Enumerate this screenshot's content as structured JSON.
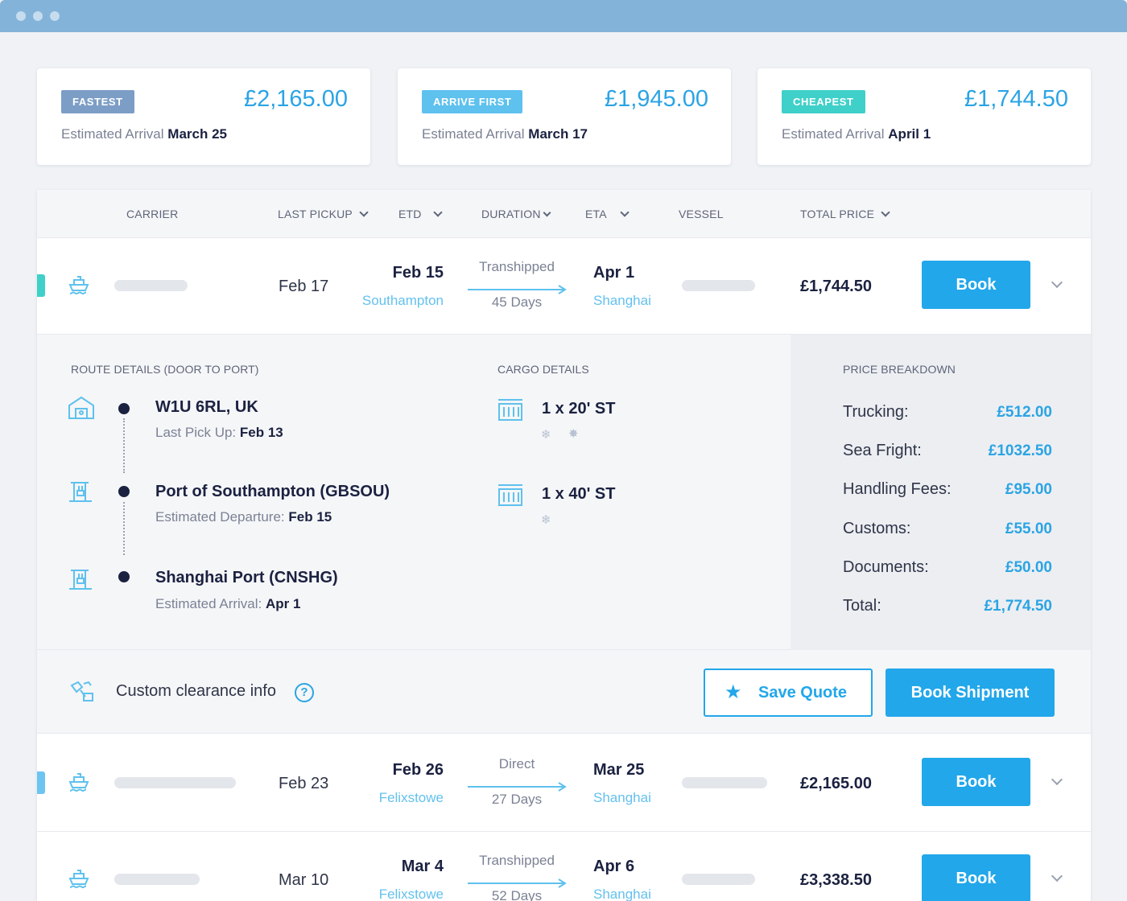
{
  "window": {
    "controls": [
      "dot",
      "dot",
      "dot"
    ]
  },
  "summary": [
    {
      "badge": "FASTEST",
      "badge_color": "#7c9ec6",
      "price": "£2,165.00",
      "arrival_label": "Estimated Arrival",
      "arrival_date": "March 25"
    },
    {
      "badge": "ARRIVE FIRST",
      "badge_color": "#5ec1ee",
      "price": "£1,945.00",
      "arrival_label": "Estimated Arrival",
      "arrival_date": "March 17"
    },
    {
      "badge": "CHEAPEST",
      "badge_color": "#3fd0c9",
      "price": "£1,744.50",
      "arrival_label": "Estimated Arrival",
      "arrival_date": "April 1"
    }
  ],
  "table_header": {
    "carrier": "CARRIER",
    "last_pickup": "LAST PICKUP",
    "etd": "ETD",
    "duration": "DURATION",
    "eta": "ETA",
    "vessel": "VESSEL",
    "total_price": "TOTAL PRICE"
  },
  "rows": [
    {
      "marker_color": "#3fd0c9",
      "pickup": "Feb 17",
      "etd_date": "Feb 15",
      "etd_port": "Southampton",
      "route_type": "Transhipped",
      "duration": "45 Days",
      "eta_date": "Apr 1",
      "eta_port": "Shanghai",
      "total": "£1,744.50",
      "book": "Book"
    },
    {
      "marker_color": "#6cc5f0",
      "pickup": "Feb 23",
      "etd_date": "Feb 26",
      "etd_port": "Felixstowe",
      "route_type": "Direct",
      "duration": "27 Days",
      "eta_date": "Mar 25",
      "eta_port": "Shanghai",
      "total": "£2,165.00",
      "book": "Book"
    },
    {
      "marker_color": "",
      "pickup": "Mar 10",
      "etd_date": "Mar 4",
      "etd_port": "Felixstowe",
      "route_type": "Transhipped",
      "duration": "52 Days",
      "eta_date": "Apr 6",
      "eta_port": "Shanghai",
      "total": "£3,338.50",
      "book": "Book"
    }
  ],
  "details": {
    "route_title": "ROUTE DETAILS (DOOR TO PORT)",
    "stops": [
      {
        "icon": "warehouse-icon",
        "name": "W1U 6RL, UK",
        "sub_label": "Last Pick Up:",
        "sub_value": "Feb 13"
      },
      {
        "icon": "port-crane-icon",
        "name": "Port of Southampton (GBSOU)",
        "sub_label": "Estimated Departure:",
        "sub_value": "Feb 15"
      },
      {
        "icon": "port-crane-icon",
        "name": "Shanghai Port (CNSHG)",
        "sub_label": "Estimated Arrival:",
        "sub_value": "Apr 1"
      }
    ],
    "cargo_title": "CARGO DETAILS",
    "cargo": [
      {
        "icon": "container-icon",
        "label": "1 x 20' ST",
        "tags": [
          "snowflake-icon",
          "hazard-icon"
        ]
      },
      {
        "icon": "container-icon",
        "label": "1 x 40' ST",
        "tags": [
          "snowflake-icon"
        ]
      }
    ],
    "price_title": "PRICE BREAKDOWN",
    "price_breakdown": [
      {
        "label": "Trucking:",
        "value": "£512.00"
      },
      {
        "label": "Sea Fright:",
        "value": "£1032.50"
      },
      {
        "label": "Handling Fees:",
        "value": "£95.00"
      },
      {
        "label": "Customs:",
        "value": "£55.00"
      },
      {
        "label": "Documents:",
        "value": "£50.00"
      },
      {
        "label": "Total:",
        "value": "£1,774.50"
      }
    ]
  },
  "actions": {
    "clearance_label": "Custom clearance info",
    "help_glyph": "?",
    "save_quote": "Save Quote",
    "save_icon": "star-icon",
    "book_shipment": "Book Shipment"
  }
}
